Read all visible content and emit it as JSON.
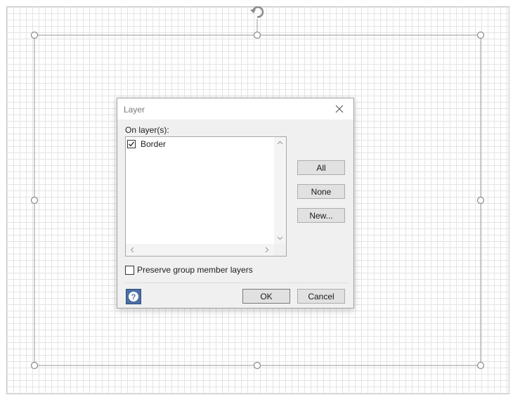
{
  "dialog": {
    "title": "Layer",
    "close_icon": "close-icon",
    "on_layers_label": "On layer(s):",
    "layers": [
      {
        "label": "Border",
        "checked": true
      }
    ],
    "buttons": {
      "all": "All",
      "none": "None",
      "new": "New...",
      "ok": "OK",
      "cancel": "Cancel"
    },
    "preserve_label": "Preserve group member layers",
    "preserve_checked": false,
    "help_icon": "help-icon"
  },
  "colors": {
    "grid_line": "#e4e4e4",
    "selection_line": "#9a9a9a",
    "help_button": "#4a6fa5"
  }
}
